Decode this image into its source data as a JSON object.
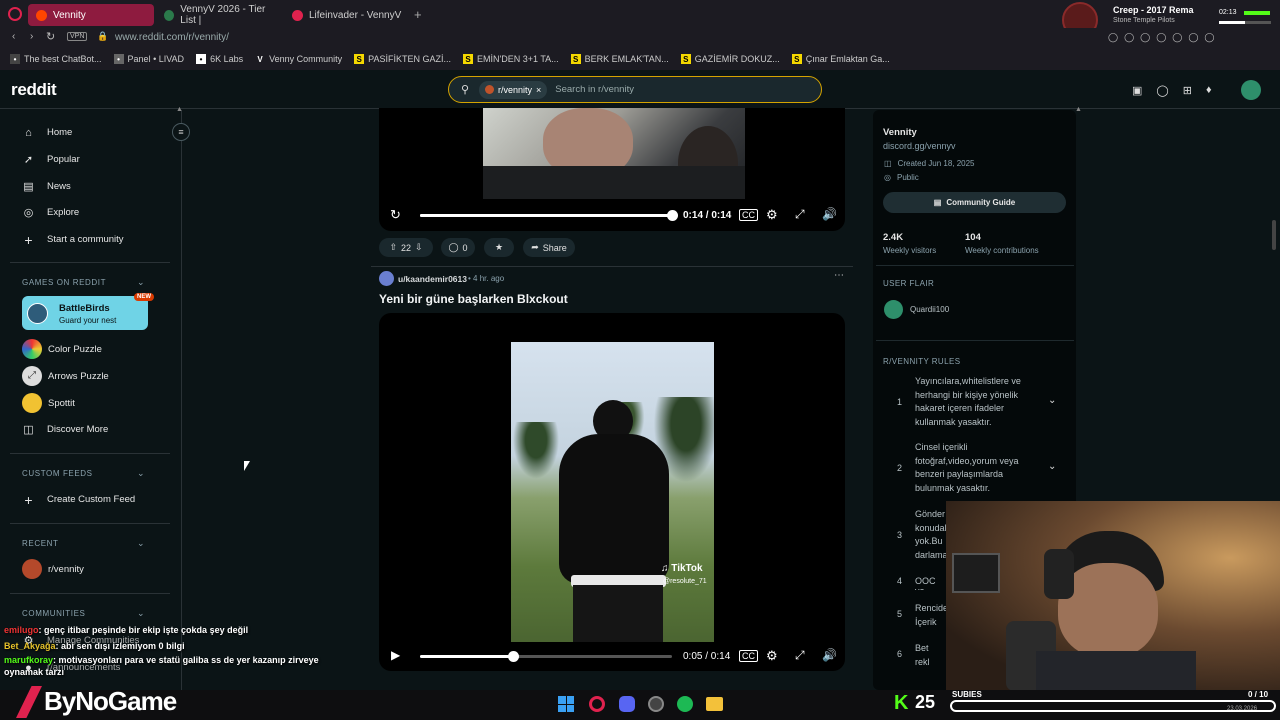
{
  "browser": {
    "tabs": [
      {
        "label": "Vennity",
        "active": true
      },
      {
        "label": "VennyV 2026 - Tier List |",
        "active": false
      },
      {
        "label": "Lifeinvader - VennyV",
        "active": false
      }
    ],
    "vpn_label": "VPN",
    "url": "www.reddit.com/r/vennity/",
    "bookmarks": [
      "The best ChatBot...",
      "Panel • LIVAD",
      "6K Labs",
      "Venny Community",
      "PASİFİKTEN GAZİ...",
      "EMİN'DEN 3+1 TA...",
      "BERK EMLAK'TAN...",
      "GAZİEMİR DOKUZ...",
      "Çınar Emlaktan Ga..."
    ]
  },
  "media_player": {
    "title": "Creep - 2017 Rema",
    "artist": "Stone Temple Pilots",
    "time": "02:13"
  },
  "reddit": {
    "logo": "reddit",
    "search_chip": "r/vennity",
    "search_placeholder": "Search in r/vennity"
  },
  "sidebar": {
    "nav": [
      "Home",
      "Popular",
      "News",
      "Explore",
      "Start a community"
    ],
    "games_header": "GAMES ON REDDIT",
    "featured_game": {
      "name": "BattleBirds",
      "tagline": "Guard your nest",
      "badge": "NEW"
    },
    "games": [
      "Color Puzzle",
      "Arrows Puzzle",
      "Spottit",
      "Discover More"
    ],
    "custom_feeds_header": "CUSTOM FEEDS",
    "create_feed": "Create Custom Feed",
    "recent_header": "RECENT",
    "recent": [
      "r/vennity"
    ],
    "communities_header": "COMMUNITIES",
    "communities": [
      "Manage Communities",
      "r/announcements"
    ]
  },
  "post1": {
    "time": "0:14 / 0:14",
    "progress": 1.0,
    "votes": "22",
    "comments": "0",
    "share": "Share"
  },
  "post2": {
    "author": "u/kaandemir0613",
    "age": "• 4 hr. ago",
    "title": "Yeni bir güne başlarken Blxckout",
    "watermark": "TikTok",
    "watermark_user": "@resolute_71",
    "time": "0:05 / 0:14",
    "progress": 0.37
  },
  "community": {
    "name": "Vennity",
    "link": "discord.gg/vennyv",
    "created": "Created Jun 18, 2025",
    "visibility": "Public",
    "guide_button": "Community Guide",
    "weekly_visitors": "2.4K",
    "weekly_visitors_label": "Weekly visitors",
    "weekly_contrib": "104",
    "weekly_contrib_label": "Weekly contributions",
    "flair_header": "USER FLAIR",
    "flair_user": "Quardii100",
    "rules_header": "R/VENNITY RULES",
    "rules": [
      {
        "n": "1",
        "text": "Yayıncılara,whitelistlere ve herhangi bir kişiye yönelik hakaret içeren ifadeler kullanmak yasaktır."
      },
      {
        "n": "2",
        "text": "Cinsel içerikli fotoğraf,video,yorum veya benzeri paylaşımlarda bulunmak yasaktır."
      },
      {
        "n": "3",
        "text": "Gönder konudal yok.Bu darlama"
      },
      {
        "n": "4",
        "text": "OOC ve"
      },
      {
        "n": "5",
        "text": "Rencide İçerik Ya"
      },
      {
        "n": "6",
        "text": "Bet rekl yasaktı"
      }
    ]
  },
  "stream": {
    "chat": [
      {
        "user": "emilugo",
        "msg": ": genç itibar peşinde bir ekip işte çokda şey değil"
      },
      {
        "user": "Bet_Akyağa",
        "msg": ": abi sen dışı izlemiyom 0 bilgi"
      },
      {
        "user": "marufkoray",
        "msg": ": motivasyonları para ve statü galiba ss de yer kazanıp zirveye oynamak tarzı"
      }
    ],
    "brand": "ByNoGame",
    "kick_count": "25",
    "subs_label": "SUBIES",
    "subs_count": "0 / 10",
    "date": "23.03.2026",
    "colors": {
      "accent": "#53fc18",
      "reddit_orange": "#ff4500",
      "search_border": "#d4a300"
    }
  }
}
